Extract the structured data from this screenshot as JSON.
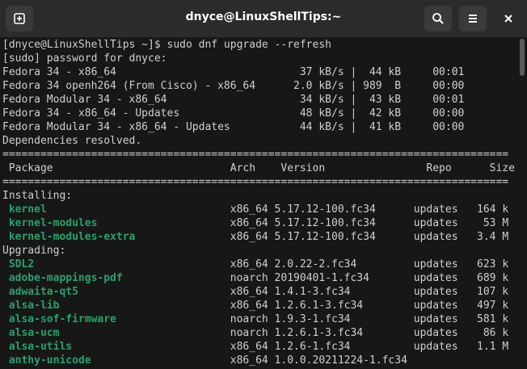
{
  "window": {
    "title": "dnyce@LinuxShellTips:~",
    "icons": {
      "new_tab": "new-tab-icon",
      "search": "search-icon",
      "menu": "hamburger-menu-icon",
      "close": "close-icon"
    }
  },
  "colors": {
    "background": "#171717",
    "text": "#d0cfcc",
    "package": "#26a269",
    "titlebar": "#2b2b2b"
  },
  "terminal": {
    "lines": [
      {
        "text": "[dnyce@LinuxShellTips ~]$ sudo dnf upgrade --refresh"
      },
      {
        "text": "[sudo] password for dnyce:"
      },
      {
        "text": "Fedora 34 - x86_64                             37 kB/s |  44 kB     00:01"
      },
      {
        "text": "Fedora 34 openh264 (From Cisco) - x86_64      2.0 kB/s | 989  B     00:00"
      },
      {
        "text": "Fedora Modular 34 - x86_64                     34 kB/s |  43 kB     00:01"
      },
      {
        "text": "Fedora 34 - x86_64 - Updates                   48 kB/s |  42 kB     00:00"
      },
      {
        "text": "Fedora Modular 34 - x86_64 - Updates           44 kB/s |  41 kB     00:00"
      },
      {
        "text": "Dependencies resolved."
      },
      {
        "text": "================================================================================"
      },
      {
        "text": " Package                            Arch    Version                Repo      Size"
      },
      {
        "text": "================================================================================"
      },
      {
        "text": "Installing:"
      },
      {
        "pre": " ",
        "pkg": "kernel",
        "rest": "                             x86_64 5.17.12-100.fc34      updates   164 k"
      },
      {
        "pre": " ",
        "pkg": "kernel-modules",
        "rest": "                     x86_64 5.17.12-100.fc34      updates    53 M"
      },
      {
        "pre": " ",
        "pkg": "kernel-modules-extra",
        "rest": "               x86_64 5.17.12-100.fc34      updates   3.4 M"
      },
      {
        "text": "Upgrading:"
      },
      {
        "pre": " ",
        "pkg": "SDL2",
        "rest": "                               x86_64 2.0.22-2.fc34         updates   623 k"
      },
      {
        "pre": " ",
        "pkg": "adobe-mappings-pdf",
        "rest": "                 noarch 20190401-1.fc34       updates   689 k"
      },
      {
        "pre": " ",
        "pkg": "adwaita-qt5",
        "rest": "                        x86_64 1.4.1-3.fc34          updates   107 k"
      },
      {
        "pre": " ",
        "pkg": "alsa-lib",
        "rest": "                           x86_64 1.2.6.1-3.fc34        updates   497 k"
      },
      {
        "pre": " ",
        "pkg": "alsa-sof-firmware",
        "rest": "                  noarch 1.9.3-1.fc34          updates   581 k"
      },
      {
        "pre": " ",
        "pkg": "alsa-ucm",
        "rest": "                           noarch 1.2.6.1-3.fc34        updates    86 k"
      },
      {
        "pre": " ",
        "pkg": "alsa-utils",
        "rest": "                         x86_64 1.2.6-1.fc34          updates   1.1 M"
      },
      {
        "pre": " ",
        "pkg": "anthy-unicode",
        "rest": "                      x86_64 1.0.0.20211224-1.fc34"
      }
    ]
  }
}
